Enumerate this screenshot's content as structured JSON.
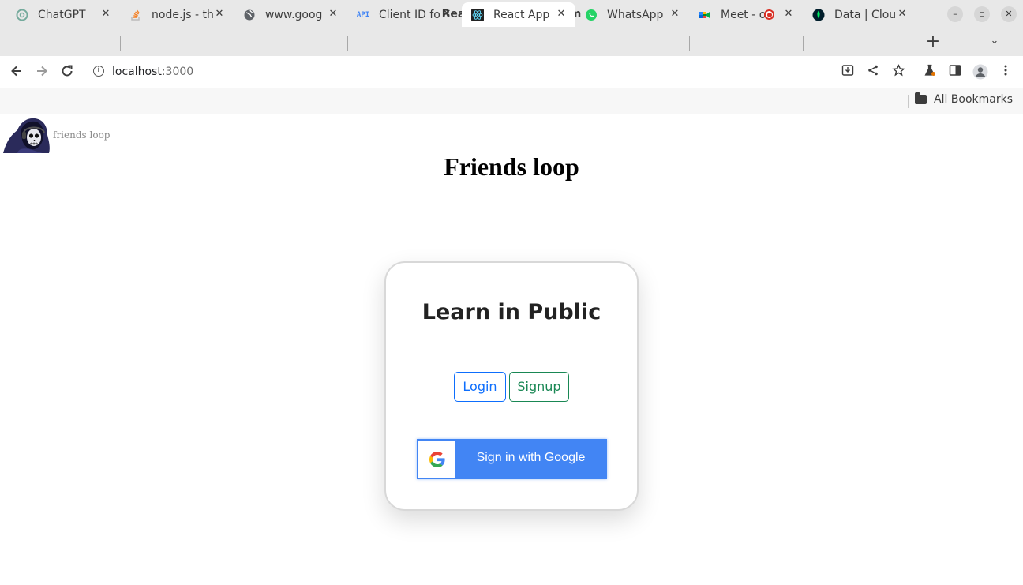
{
  "window": {
    "title": "React App - Chromium"
  },
  "tabs": [
    {
      "label": "ChatGPT",
      "icon": "chatgpt-icon"
    },
    {
      "label": "node.js - th",
      "icon": "stackoverflow-icon"
    },
    {
      "label": "www.goog",
      "icon": "globe-icon"
    },
    {
      "label": "Client ID fo",
      "icon": "api-icon"
    },
    {
      "label": "React App",
      "icon": "react-icon",
      "active": true
    },
    {
      "label": "WhatsApp",
      "icon": "whatsapp-icon"
    },
    {
      "label": "Meet - o",
      "icon": "google-meet-icon",
      "recording": true
    },
    {
      "label": "Data | Clou",
      "icon": "mongodb-icon"
    }
  ],
  "toolbar": {
    "url_host": "localhost",
    "url_port": ":3000"
  },
  "bookmarks": {
    "all_label": "All Bookmarks"
  },
  "page": {
    "brand_text": "friends loop",
    "title": "Friends loop",
    "card": {
      "title": "Learn in Public",
      "login_label": "Login",
      "signup_label": "Signup",
      "google_label": "Sign in with Google"
    }
  },
  "colors": {
    "login": "#0d6efd",
    "signup": "#198754",
    "google_blue": "#4285f4"
  }
}
